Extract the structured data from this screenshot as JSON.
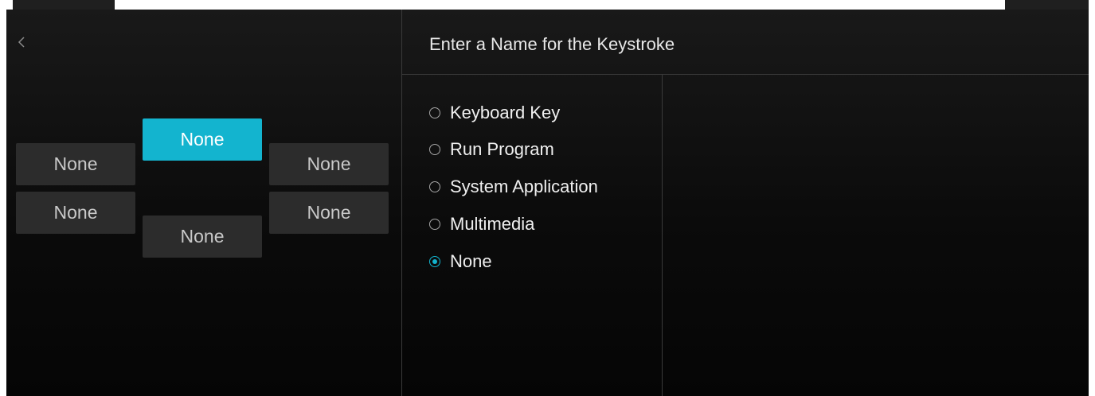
{
  "dialog": {
    "title": "Enter a Name for the Keystroke"
  },
  "keys": {
    "top_center": "None",
    "upper_left": "None",
    "upper_right": "None",
    "lower_left": "None",
    "lower_right": "None",
    "bottom_center": "None",
    "selected": "top_center"
  },
  "options": [
    {
      "label": "Keyboard Key",
      "checked": false
    },
    {
      "label": "Run Program",
      "checked": false
    },
    {
      "label": "System Application",
      "checked": false
    },
    {
      "label": "Multimedia",
      "checked": false
    },
    {
      "label": "None",
      "checked": true
    }
  ],
  "colors": {
    "accent": "#13b4cf",
    "button_bg": "#2c2c2c",
    "background": "#121212"
  },
  "icons": {
    "back": "chevron-left-icon"
  }
}
